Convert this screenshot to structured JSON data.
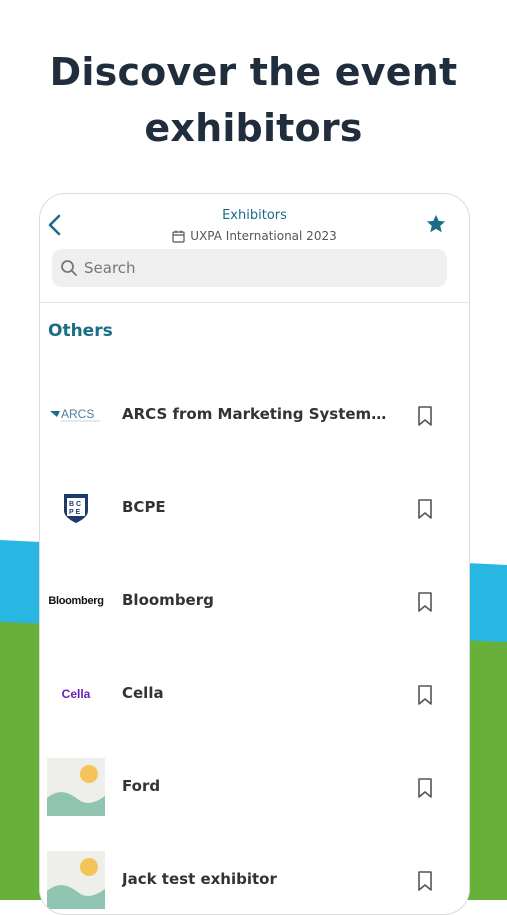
{
  "headline": {
    "line1": "Discover the event",
    "line2": "exhibitors"
  },
  "app_bar": {
    "title": "Exhibitors",
    "subtitle": "UXPA International 2023"
  },
  "search": {
    "placeholder": "Search"
  },
  "section": {
    "title": "Others"
  },
  "exhibitors": [
    {
      "name": "ARCS from Marketing Systems Gr...",
      "logo_text": "ARCS",
      "logo": "arcs-logo"
    },
    {
      "name": "BCPE",
      "logo_text": "BCPE",
      "logo": "bcpe-logo"
    },
    {
      "name": "Bloomberg",
      "logo_text": "Bloomberg",
      "logo": "bloomberg-logo"
    },
    {
      "name": "Cella",
      "logo_text": "Cella",
      "logo": "cella-logo"
    },
    {
      "name": "Ford",
      "logo": "image-placeholder-icon"
    },
    {
      "name": "Jack test exhibitor",
      "logo": "image-placeholder-icon"
    }
  ],
  "colors": {
    "accent": "#1b6d86",
    "sky": "#28b7e3",
    "grass": "#67b03a"
  }
}
